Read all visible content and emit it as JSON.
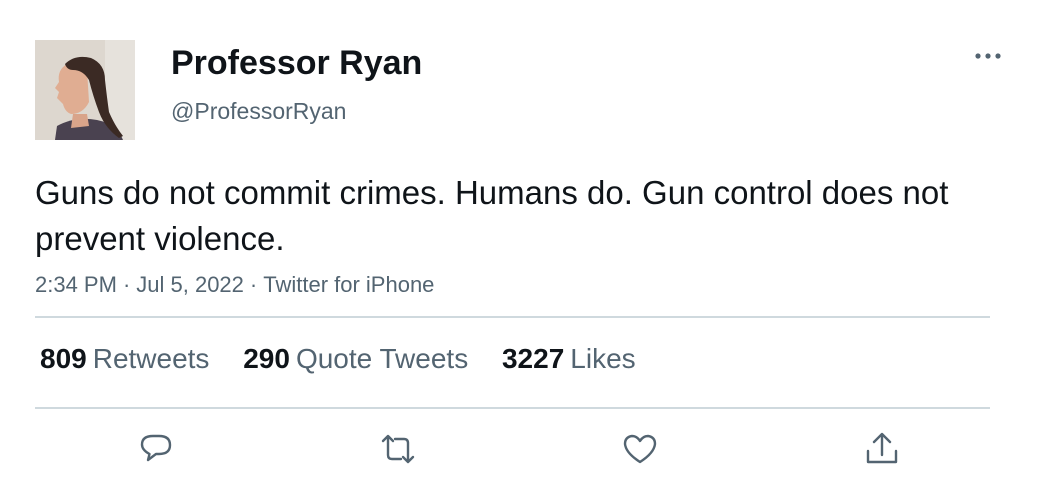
{
  "author": {
    "display_name": "Professor Ryan",
    "handle": "@ProfessorRyan"
  },
  "tweet": {
    "text": "Guns do not commit crimes. Humans do. Gun control does not prevent violence.",
    "time": "2:34 PM",
    "date": "Jul 5, 2022",
    "source": "Twitter for iPhone",
    "separator": "·"
  },
  "stats": {
    "retweets": {
      "count": "809",
      "label": "Retweets"
    },
    "quote_tweets": {
      "count": "290",
      "label": "Quote Tweets"
    },
    "likes": {
      "count": "3227",
      "label": "Likes"
    }
  },
  "icons": {
    "more": "more-horizontal-icon",
    "reply": "reply-icon",
    "retweet": "retweet-icon",
    "like": "heart-icon",
    "share": "share-icon"
  },
  "colors": {
    "text": "#0f1419",
    "secondary": "#536471",
    "divider": "#cfd9de"
  }
}
